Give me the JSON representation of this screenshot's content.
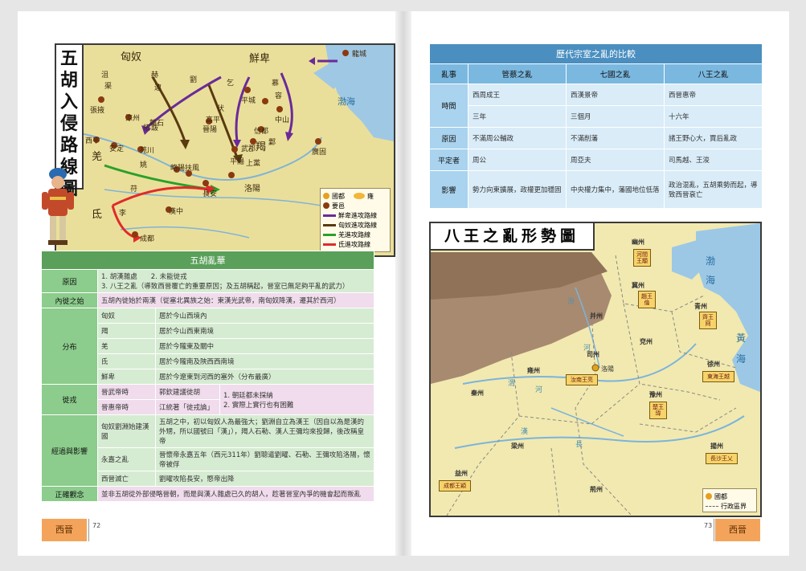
{
  "left_page": {
    "map": {
      "title_chars": [
        "五",
        "胡",
        "入",
        "侵",
        "路",
        "線",
        "圖"
      ],
      "regions": {
        "xiongnu": "匈奴",
        "xianbei": "鮮卑",
        "qiang": "羌",
        "di": "氐",
        "jie": "羯"
      },
      "sea": "渤海",
      "places": {
        "longcheng": "龍城",
        "pingcheng": "平城",
        "zhongshan": "中山",
        "xindu": "信都",
        "ye": "鄴",
        "guanggu": "廣固",
        "wuyuan": "武郡",
        "shangdang": "上黨",
        "pingyang": "平陽",
        "jinyang": "晉陽",
        "luoyang": "洛陽",
        "changan": "長安",
        "hanzhong": "漢中",
        "chengdu": "成都",
        "zhangye": "張掖",
        "xiping": "西平",
        "ancheng": "安定",
        "fufeng": "扶風",
        "didao": "狄道",
        "tianshui": "天水",
        "liangzhou": "涼州",
        "wanchuan": "苑川",
        "biyang": "略陽",
        "gaoping": "高平",
        "lishi": "離石"
      },
      "tribes_small": [
        "薛",
        "赫",
        "連",
        "劉",
        "乞",
        "伏",
        "慕",
        "容",
        "鐵",
        "弗",
        "拓",
        "跋",
        "姚",
        "苻",
        "沮",
        "渠",
        "李"
      ],
      "legend": {
        "capital": "國都",
        "yongzhou": "雍",
        "important": "要邑",
        "routes": [
          "鮮卑進攻路線",
          "匈奴進攻路線",
          "羌進攻路線",
          "氐進攻路線"
        ]
      },
      "colors": {
        "xianbei": "#6a2a9a",
        "xiongnu": "#5a3a10",
        "qiang": "#2aa02a",
        "di": "#e02a2a"
      }
    },
    "table": {
      "title": "五胡亂華",
      "causes_label": "原因",
      "causes_line1": "1. 胡漢雜處　　2. 未能徙戎",
      "causes_line2": "3. 八王之亂（導致西晉覆亡的重要原因；及五胡稱起，晉室已無足夠平亂的武力）",
      "inner_label": "內徙之始",
      "inner_text": "五胡內徙始於兩漢（從塞北異族之始：東漢光武帝，南匈奴降漢，遷其於西河）",
      "distribution_label": "分布",
      "distribution": [
        {
          "name": "匈奴",
          "text": "居於今山西境內"
        },
        {
          "name": "羯",
          "text": "居於今山西東南境"
        },
        {
          "name": "羌",
          "text": "居於今隴東及關中"
        },
        {
          "name": "氐",
          "text": "居於今隴南及陝西西南境"
        },
        {
          "name": "鮮卑",
          "text": "居於今遼東到河西的塞外（分布最廣）"
        }
      ],
      "xurong_label": "徙戎",
      "xurong": [
        {
          "emperor": "晉武帝時",
          "person": "郭欽建議徙胡"
        },
        {
          "emperor": "晉惠帝時",
          "person": "江統著「徙戎論」"
        }
      ],
      "xurong_result": "1. 朝廷都未採納\n2. 實際上實行也有困難",
      "process_label": "經過與影響",
      "process": [
        {
          "name": "匈奴劉淵始建漢國",
          "text": "五胡之中，初以匈奴人為最強大；劉淵自立為漢王（因自以為是漢的外甥，所以國號曰「漢」），羯人石勒、漢人王彌均來投歸，後改稱皇帝"
        },
        {
          "name": "永嘉之亂",
          "text": "晉懷帝永嘉五年（西元311年）劉聰遣劉曜、石勒、王彌攻陷洛陽，懷帝被俘"
        },
        {
          "name": "西晉滅亡",
          "text": "劉曜攻陷長安，愍帝出降"
        }
      ],
      "correct_label": "正確觀念",
      "correct_text": "並非五胡從外部侵略晉朝，而是與漢人雜處已久的胡人，趁著晉室內爭的機會起而叛亂"
    },
    "footer": {
      "tab": "西晉",
      "page": "72"
    }
  },
  "right_page": {
    "table": {
      "title": "歷代宗室之亂的比較",
      "columns": [
        "亂事",
        "管蔡之亂",
        "七國之亂",
        "八王之亂"
      ],
      "rows": [
        {
          "label": "時間",
          "cells": [
            [
              "西周成王",
              "三年"
            ],
            [
              "西漢景帝",
              "三個月"
            ],
            [
              "西晉惠帝",
              "十六年"
            ]
          ]
        },
        {
          "label": "原因",
          "cells": [
            [
              "不滿周公輔政"
            ],
            [
              "不滿削藩"
            ],
            [
              "諸王野心大，賈后亂政"
            ]
          ]
        },
        {
          "label": "平定者",
          "cells": [
            [
              "周公"
            ],
            [
              "周亞夫"
            ],
            [
              "司馬越、王浚"
            ]
          ]
        },
        {
          "label": "影響",
          "cells": [
            [
              "勢力向東擴展，政權更加穩固"
            ],
            [
              "中央權力集中，藩國地位低落"
            ],
            [
              "政治混亂，五胡乘勢而起，導致西晉衰亡"
            ]
          ]
        }
      ]
    },
    "map": {
      "title": "八王之亂形勢圖",
      "provinces": {
        "youzhou": "幽州",
        "jizhou": "冀州",
        "bingzhou": "并州",
        "yanzhou": "兗州",
        "qingzhou": "青州",
        "sizhou": "司州",
        "xuzhou": "徐州",
        "yongzhou": "雍州",
        "yuzhou": "豫州",
        "qinzhou": "秦州",
        "liangzhou": "梁州",
        "jingzhou": "荊州",
        "yangzhou": "揚州",
        "yizhou": "益州"
      },
      "rivers": {
        "fen": "汾",
        "he1": "河",
        "he2": "河",
        "wei": "渭",
        "han": "漢",
        "chang": "長"
      },
      "seas": {
        "bo1": "渤",
        "bo2": "海",
        "huang1": "黃",
        "huang2": "海"
      },
      "city": "洛陽",
      "kings": {
        "hejian": "河間王顒",
        "zhao": "趙王倫",
        "qi": "齊王冏",
        "donghai": "東海王越",
        "henan": "汝南王亮",
        "chu": "楚王瑋",
        "changsha": "長沙王乂",
        "chengdu": "成都王穎"
      },
      "legend": {
        "capital": "國都",
        "border": "行政區界"
      }
    },
    "footer": {
      "tab": "西晉",
      "page": "73"
    }
  }
}
